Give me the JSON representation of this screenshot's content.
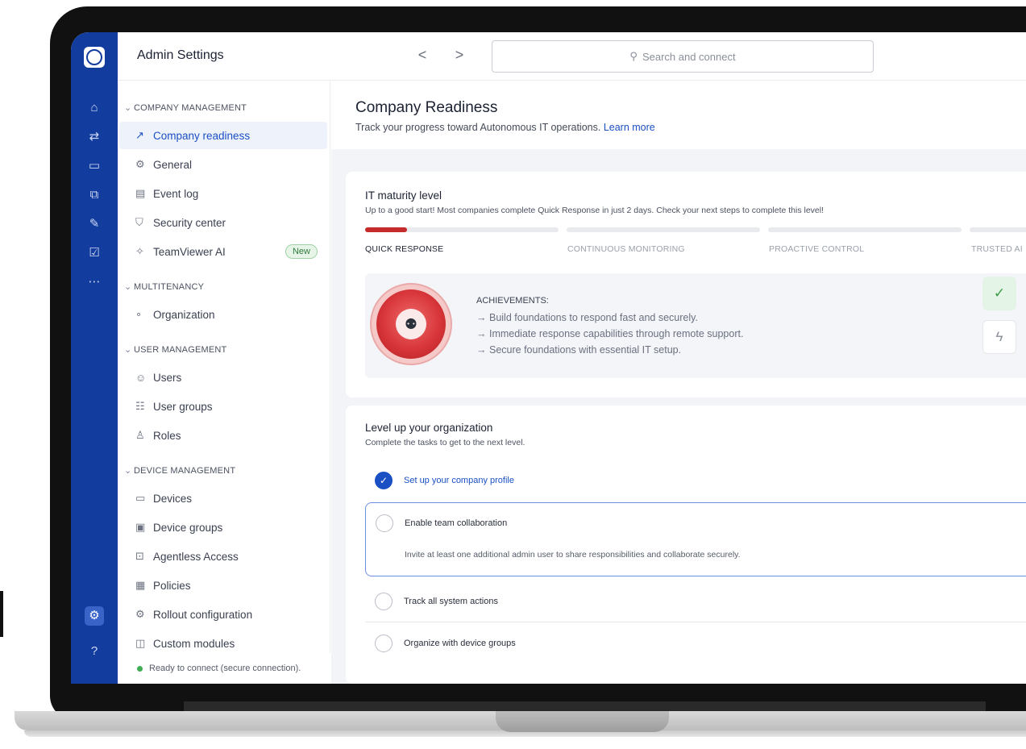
{
  "header": {
    "app_title": "Admin Settings",
    "back_label": "<",
    "forward_label": ">",
    "search_placeholder": "Search and connect"
  },
  "rail": {
    "icons": [
      "home-icon",
      "transfer-icon",
      "devices-icon",
      "remote-icon",
      "tools-icon",
      "check-icon",
      "more-icon",
      "settings-icon",
      "help-icon"
    ]
  },
  "sidebar": {
    "sections": {
      "company": "COMPANY MANAGEMENT",
      "multitenancy": "MULTITENANCY",
      "user": "USER MANAGEMENT",
      "device": "DEVICE MANAGEMENT"
    },
    "items": {
      "company_readiness": "Company readiness",
      "general": "General",
      "event_log": "Event log",
      "security_center": "Security center",
      "teamviewer_ai": "TeamViewer AI",
      "new_badge": "New",
      "organization": "Organization",
      "users": "Users",
      "user_groups": "User groups",
      "roles": "Roles",
      "devices": "Devices",
      "device_groups": "Device groups",
      "agentless_access": "Agentless Access",
      "policies": "Policies",
      "rollout_configuration": "Rollout configuration",
      "custom_modules": "Custom modules"
    },
    "status": "Ready to connect (secure connection)."
  },
  "page": {
    "title": "Company Readiness",
    "subtitle": "Track your progress toward Autonomous IT operations.",
    "learn_more": "Learn more"
  },
  "maturity": {
    "title": "IT maturity level",
    "subtitle": "Up to a good start! Most companies complete Quick Response in just 2 days. Check your next steps to complete this level!",
    "stages": [
      "QUICK RESPONSE",
      "CONTINUOUS MONITORING",
      "PROACTIVE CONTROL",
      "TRUSTED AI"
    ],
    "progress_fraction": 0.06,
    "achievements_label": "ACHIEVEMENTS:",
    "achievements": [
      "Build foundations to respond fast and securely.",
      "Immediate response capabilities through remote support.",
      "Secure foundations with essential IT setup."
    ]
  },
  "levelup": {
    "title": "Level up your organization",
    "subtitle": "Complete the tasks to get to the next level.",
    "tasks": [
      {
        "label": "Set up your company profile",
        "done": true
      },
      {
        "label": "Enable team collaboration",
        "done": false,
        "description": "Invite at least one additional admin user to share responsibilities and collaborate securely."
      },
      {
        "label": "Track all system actions",
        "done": false
      },
      {
        "label": "Organize with device groups",
        "done": false
      }
    ]
  },
  "colors": {
    "rail": "#123c9e",
    "accent": "#1b4fc4",
    "danger": "#c52b2b",
    "success": "#3fae52"
  }
}
